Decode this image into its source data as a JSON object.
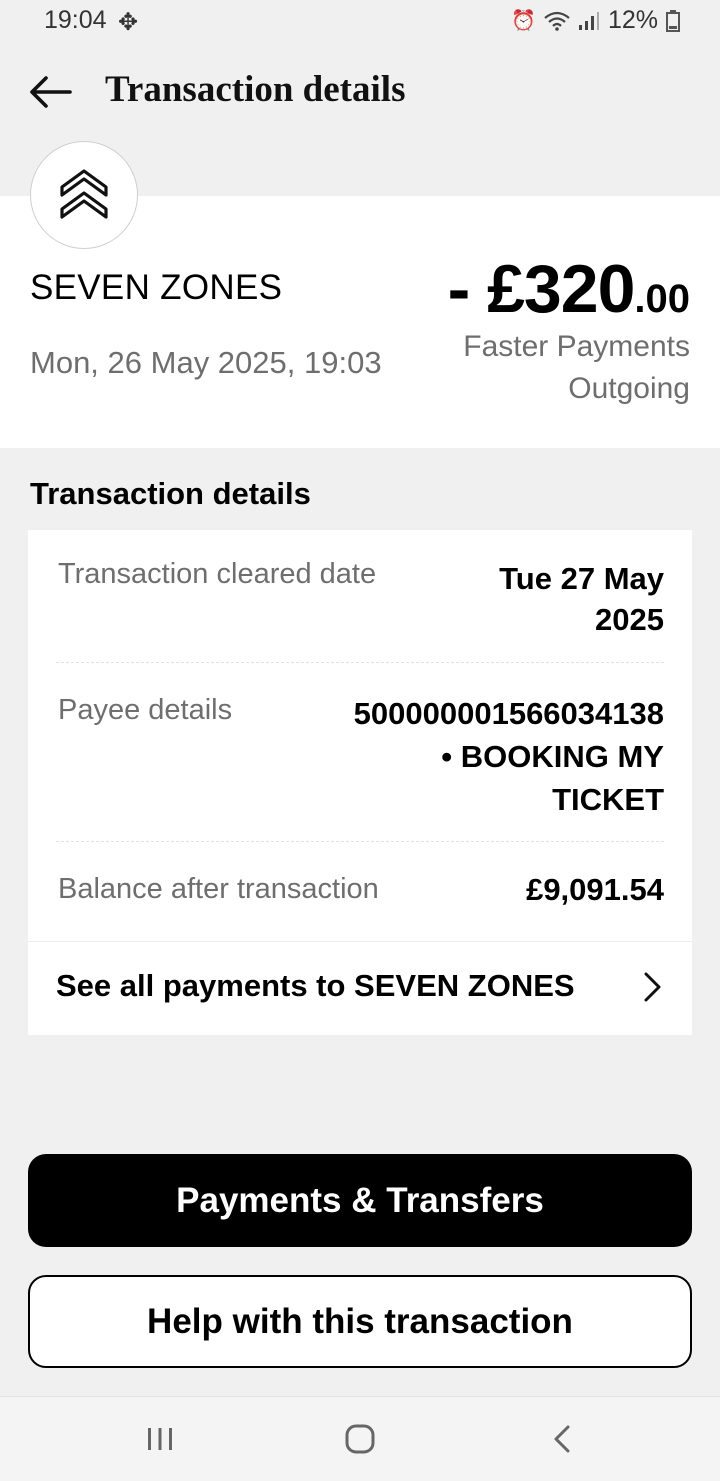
{
  "status_bar": {
    "time": "19:04",
    "battery": "12%",
    "icons": [
      "fan-icon",
      "alarm-icon",
      "wifi-icon",
      "signal-icon",
      "battery-icon"
    ]
  },
  "app_bar": {
    "title": "Transaction details",
    "back_icon": "arrow-left-icon"
  },
  "summary": {
    "merchant_name": "SEVEN ZONES",
    "datetime": "Mon, 26 May 2025, 19:03",
    "amount_major": "- £320",
    "amount_minor": ".00",
    "type_line1": "Faster Payments",
    "type_line2": "Outgoing",
    "logo_icon": "double-chevron-up-icon"
  },
  "details": {
    "section_title": "Transaction details",
    "rows": [
      {
        "label": "Transaction cleared date",
        "value_line1": "Tue 27 May",
        "value_line2": "2025"
      },
      {
        "label": "Payee details",
        "value_line1": "500000001566034138",
        "value_line2": "• BOOKING MY",
        "value_line3": "TICKET"
      },
      {
        "label": "Balance after transaction",
        "value_line1": "£9,091.54"
      }
    ],
    "see_all": "See all payments to SEVEN ZONES"
  },
  "actions": {
    "primary": "Payments & Transfers",
    "secondary": "Help with this transaction"
  },
  "colors": {
    "background": "#f0f0f0",
    "card": "#ffffff",
    "muted_text": "#6e6e6e",
    "primary_button": "#000000"
  }
}
